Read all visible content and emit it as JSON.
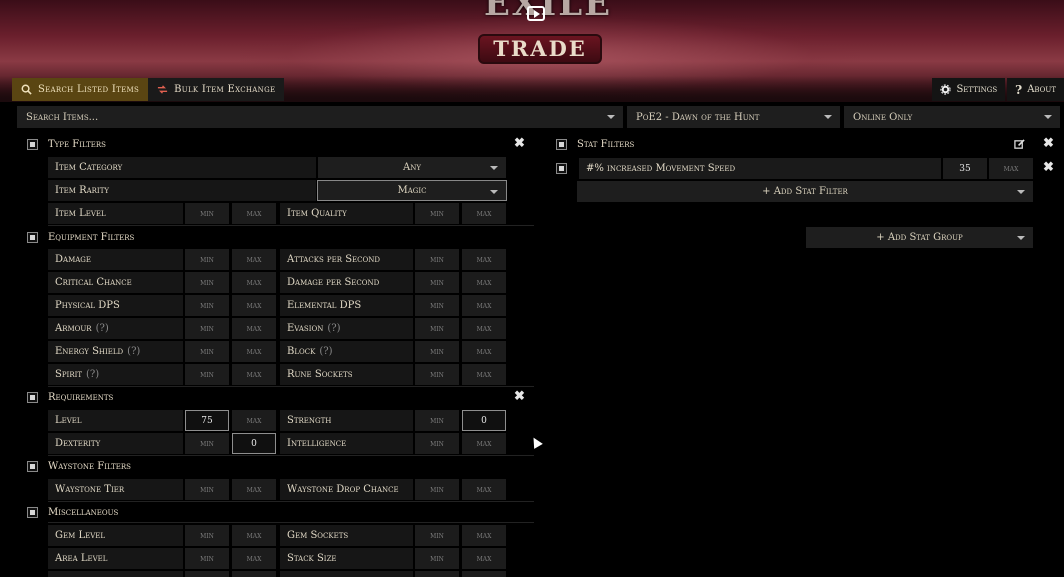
{
  "banner": {
    "logo_top": "EXILE",
    "logo_trade": "TRADE"
  },
  "tabs": [
    {
      "label": "Search Listed Items"
    },
    {
      "label": "Bulk Item Exchange"
    }
  ],
  "topright": {
    "settings": "Settings",
    "about": "About"
  },
  "search": {
    "items": "Search Items...",
    "league": "PoE2 - Dawn of the Hunt",
    "status": "Online Only"
  },
  "common": {
    "min": "min",
    "max": "max"
  },
  "type_filters": {
    "title": "Type Filters",
    "item_category": {
      "label": "Item Category",
      "value": "Any"
    },
    "item_rarity": {
      "label": "Item Rarity",
      "value": "Magic"
    },
    "item_level": "Item Level",
    "item_quality": "Item Quality"
  },
  "equipment_filters": {
    "title": "Equipment Filters",
    "rows": [
      [
        "Damage",
        "Attacks per Second"
      ],
      [
        "Critical Chance",
        "Damage per Second"
      ],
      [
        "Physical DPS",
        "Elemental DPS"
      ],
      [
        "Armour",
        "Evasion"
      ],
      [
        "Energy Shield",
        "Block"
      ],
      [
        "Spirit",
        "Rune Sockets"
      ]
    ],
    "hint": "(?)"
  },
  "requirements": {
    "title": "Requirements",
    "level": {
      "label": "Level",
      "min": "75"
    },
    "strength": {
      "label": "Strength",
      "max": "0"
    },
    "dexterity": {
      "label": "Dexterity",
      "max": "0"
    },
    "intelligence": "Intelligence"
  },
  "waystone_filters": {
    "title": "Waystone Filters",
    "tier": "Waystone Tier",
    "drop": "Waystone Drop Chance"
  },
  "miscellaneous": {
    "title": "Miscellaneous",
    "rows": [
      [
        "Gem Level",
        "Gem Sockets"
      ],
      [
        "Area Level",
        "Stack Size"
      ]
    ]
  },
  "stat_filters": {
    "title": "Stat Filters",
    "stat": {
      "label": "#% increased Movement Speed",
      "min": "35"
    },
    "add_filter": "+ Add Stat Filter",
    "add_group": "+ Add Stat Group"
  }
}
